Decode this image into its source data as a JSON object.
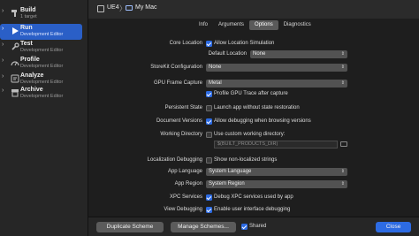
{
  "sidebar": {
    "items": [
      {
        "title": "Build",
        "subtitle": "1 target",
        "icon": "hammer-icon",
        "selected": false
      },
      {
        "title": "Run",
        "subtitle": "Development Editor",
        "icon": "play-icon",
        "selected": true
      },
      {
        "title": "Test",
        "subtitle": "Development Editor",
        "icon": "wrench-icon",
        "selected": false
      },
      {
        "title": "Profile",
        "subtitle": "Development Editor",
        "icon": "gauge-icon",
        "selected": false
      },
      {
        "title": "Analyze",
        "subtitle": "Development Editor",
        "icon": "analyze-icon",
        "selected": false
      },
      {
        "title": "Archive",
        "subtitle": "Development Editor",
        "icon": "archive-icon",
        "selected": false
      }
    ]
  },
  "topbar": {
    "scheme": "UE4",
    "separator": "〉",
    "destination": "My Mac"
  },
  "tabs": [
    {
      "label": "Info",
      "active": false
    },
    {
      "label": "Arguments",
      "active": false
    },
    {
      "label": "Options",
      "active": true
    },
    {
      "label": "Diagnostics",
      "active": false
    }
  ],
  "options": {
    "core_location_label": "Core Location",
    "allow_location_label": "Allow Location Simulation",
    "default_location_label": "Default Location",
    "default_location_value": "None",
    "storekit_label": "StoreKit Configuration",
    "storekit_value": "None",
    "gpu_capture_label": "GPU Frame Capture",
    "gpu_capture_value": "Metal",
    "gpu_trace_label": "Profile GPU Trace after capture",
    "persistent_label": "Persistent State",
    "persistent_text": "Launch app without state restoration",
    "document_versions_label": "Document Versions",
    "document_versions_text": "Allow debugging when browsing versions",
    "working_dir_label": "Working Directory",
    "working_dir_text": "Use custom working directory:",
    "working_dir_placeholder": "$(BUILT_PRODUCTS_DIR)",
    "localization_label": "Localization Debugging",
    "localization_text": "Show non-localized strings",
    "app_language_label": "App Language",
    "app_language_value": "System Language",
    "app_region_label": "App Region",
    "app_region_value": "System Region",
    "xpc_label": "XPC Services",
    "xpc_text": "Debug XPC services used by app",
    "view_debug_label": "View Debugging",
    "view_debug_text": "Enable user interface debugging"
  },
  "footer": {
    "duplicate_label": "Duplicate Scheme",
    "manage_label": "Manage Schemes...",
    "shared_label": "Shared",
    "close_label": "Close"
  },
  "colors": {
    "accent": "#2d6be3",
    "selection": "#2a5fc7"
  }
}
